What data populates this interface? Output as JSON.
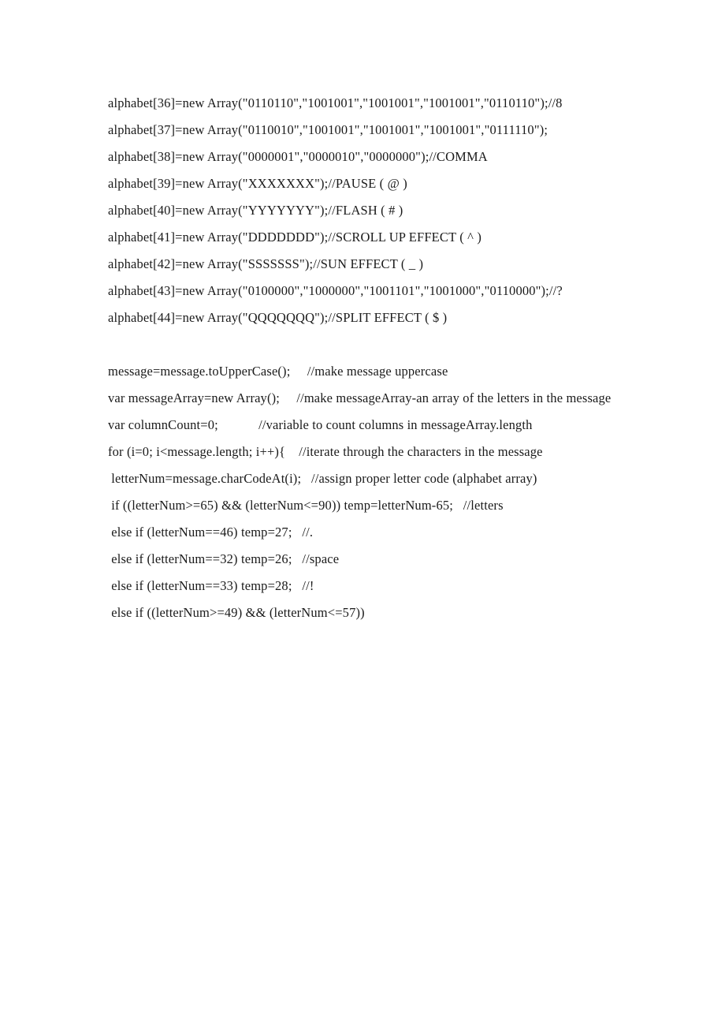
{
  "document": {
    "type": "source-code-listing",
    "language": "JavaScript",
    "page_background": "#ffffff",
    "text_color": "#1a1a1a",
    "lines": [
      "alphabet[36]=new Array(\"0110110\",\"1001001\",\"1001001\",\"1001001\",\"0110110\");//8",
      "alphabet[37]=new Array(\"0110010\",\"1001001\",\"1001001\",\"1001001\",\"0111110\");",
      "alphabet[38]=new Array(\"0000001\",\"0000010\",\"0000000\");//COMMA",
      "alphabet[39]=new Array(\"XXXXXXX\");//PAUSE ( @ )",
      "alphabet[40]=new Array(\"YYYYYYY\");//FLASH ( # )",
      "alphabet[41]=new Array(\"DDDDDDD\");//SCROLL UP EFFECT ( ^ )",
      "alphabet[42]=new Array(\"SSSSSSS\");//SUN EFFECT ( _ )",
      "alphabet[43]=new Array(\"0100000\",\"1000000\",\"1001101\",\"1001000\",\"0110000\");//?",
      "alphabet[44]=new Array(\"QQQQQQQ\");//SPLIT EFFECT ( $ )",
      "",
      "message=message.toUpperCase();     //make message uppercase",
      "var messageArray=new Array();     //make messageArray-an array of the letters in the message",
      "var columnCount=0;            //variable to count columns in messageArray.length",
      "for (i=0; i<message.length; i++){    //iterate through the characters in the message",
      " letterNum=message.charCodeAt(i);   //assign proper letter code (alphabet array)",
      " if ((letterNum>=65) && (letterNum<=90)) temp=letterNum-65;   //letters",
      " else if (letterNum==46) temp=27;   //.",
      " else if (letterNum==32) temp=26;   //space",
      " else if (letterNum==33) temp=28;   //!",
      " else if ((letterNum>=49) && (letterNum<=57))"
    ]
  }
}
